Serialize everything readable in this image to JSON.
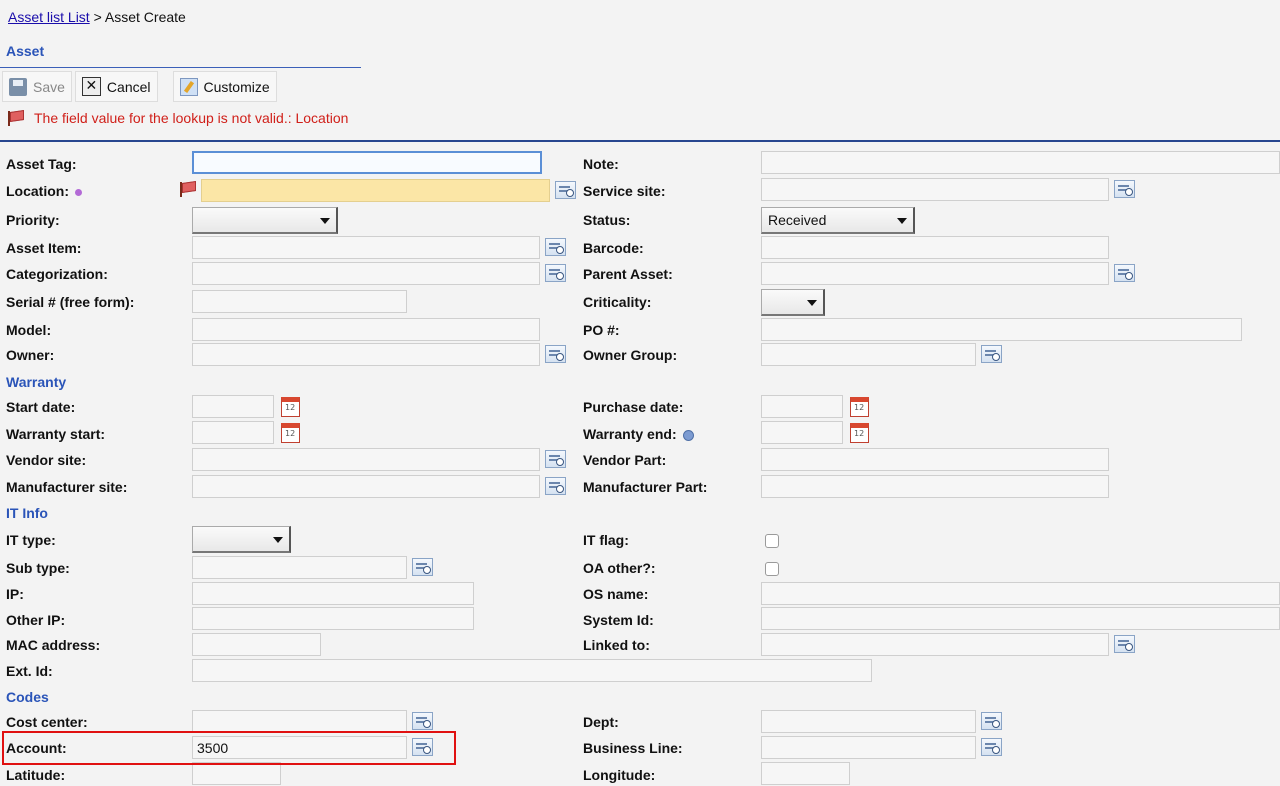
{
  "breadcrumb": {
    "link": "Asset list List",
    "separator": ">",
    "current": "Asset Create"
  },
  "section_title": "Asset",
  "toolbar": {
    "save": "Save",
    "cancel": "Cancel",
    "customize": "Customize"
  },
  "error_message": "The field value for the lookup is not valid.: Location",
  "labels": {
    "asset_tag": "Asset Tag:",
    "note": "Note:",
    "location": "Location:",
    "service_site": "Service site:",
    "priority": "Priority:",
    "status": "Status:",
    "asset_item": "Asset Item:",
    "barcode": "Barcode:",
    "categorization": "Categorization:",
    "parent_asset": "Parent Asset:",
    "serial": "Serial # (free form):",
    "criticality": "Criticality:",
    "model": "Model:",
    "po": "PO #:",
    "owner": "Owner:",
    "owner_group": "Owner Group:",
    "start_date": "Start date:",
    "purchase_date": "Purchase date:",
    "warranty_start": "Warranty start:",
    "warranty_end": "Warranty end:",
    "vendor_site": "Vendor site:",
    "vendor_part": "Vendor Part:",
    "manufacturer_site": "Manufacturer site:",
    "manufacturer_part": "Manufacturer Part:",
    "it_type": "IT type:",
    "it_flag": "IT flag:",
    "sub_type": "Sub type:",
    "oa_other": "OA other?:",
    "ip": "IP:",
    "os_name": "OS name:",
    "other_ip": "Other IP:",
    "system_id": "System Id:",
    "mac": "MAC address:",
    "linked_to": "Linked to:",
    "ext_id": "Ext. Id:",
    "cost_center": "Cost center:",
    "dept": "Dept:",
    "account": "Account:",
    "business_line": "Business Line:",
    "latitude": "Latitude:",
    "longitude": "Longitude:"
  },
  "groups": {
    "warranty": "Warranty",
    "it_info": "IT Info",
    "codes": "Codes"
  },
  "values": {
    "status": "Received",
    "account": "3500",
    "priority": "",
    "criticality": "",
    "it_type": ""
  },
  "colors": {
    "error": "#d0201a",
    "group_heading": "#2a54b8",
    "highlight": "#e01010",
    "invalid_field": "#fbe6a6"
  }
}
